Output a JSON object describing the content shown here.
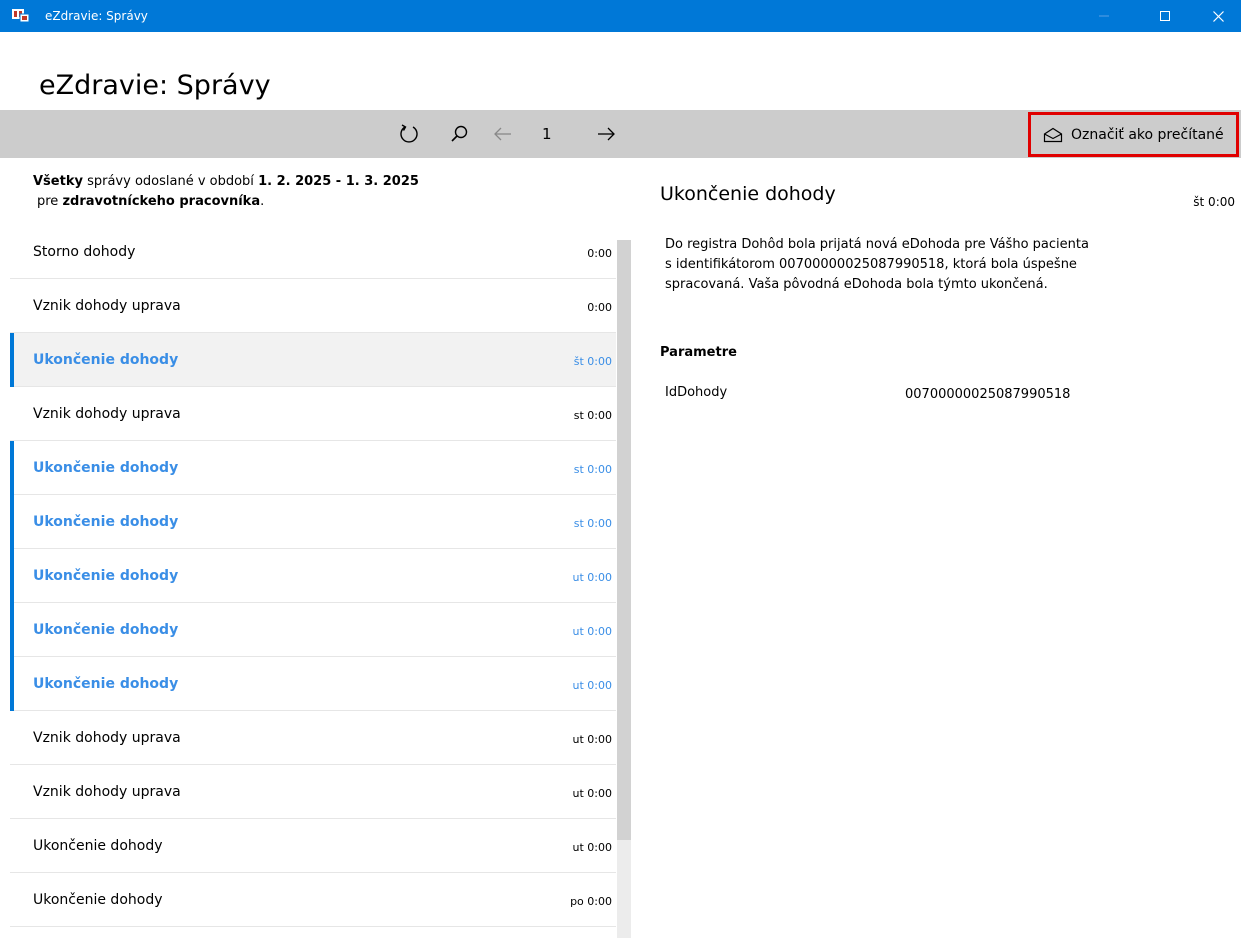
{
  "window": {
    "title": "eZdravie: Správy",
    "icon": "ezdravie-app-icon"
  },
  "page": {
    "title": "eZdravie: Správy"
  },
  "toolbar": {
    "refresh_icon": "refresh-icon",
    "search_icon": "search-icon",
    "prev_icon": "arrow-left-icon",
    "page_number": "1",
    "next_icon": "arrow-right-icon",
    "mark_read_label": "Označiť ako prečítané",
    "mark_read_icon": "open-envelope-icon",
    "highlight_color": "#e00000"
  },
  "filter": {
    "scope": "Všetky",
    "text1": " správy odoslané v období ",
    "period": "1. 2. 2025 - 1. 3. 2025",
    "text2": "pre ",
    "recipient": "zdravotníckeho pracovníka",
    "end": "."
  },
  "messages": [
    {
      "subject": "Storno dohody",
      "time": "0:00",
      "unread": false,
      "selected": false
    },
    {
      "subject": "Vznik dohody uprava",
      "time": "0:00",
      "unread": false,
      "selected": false
    },
    {
      "subject": "Ukončenie dohody",
      "time": "št 0:00",
      "unread": true,
      "selected": true
    },
    {
      "subject": "Vznik dohody uprava",
      "time": "st 0:00",
      "unread": false,
      "selected": false
    },
    {
      "subject": "Ukončenie dohody",
      "time": "st 0:00",
      "unread": true,
      "selected": false
    },
    {
      "subject": "Ukončenie dohody",
      "time": "st 0:00",
      "unread": true,
      "selected": false
    },
    {
      "subject": "Ukončenie dohody",
      "time": "ut 0:00",
      "unread": true,
      "selected": false
    },
    {
      "subject": "Ukončenie dohody",
      "time": "ut 0:00",
      "unread": true,
      "selected": false
    },
    {
      "subject": "Ukončenie dohody",
      "time": "ut 0:00",
      "unread": true,
      "selected": false
    },
    {
      "subject": "Vznik dohody uprava",
      "time": "ut 0:00",
      "unread": false,
      "selected": false
    },
    {
      "subject": "Vznik dohody uprava",
      "time": "ut 0:00",
      "unread": false,
      "selected": false
    },
    {
      "subject": "Ukončenie dohody",
      "time": "ut 0:00",
      "unread": false,
      "selected": false
    },
    {
      "subject": "Ukončenie dohody",
      "time": "po 0:00",
      "unread": false,
      "selected": false
    }
  ],
  "detail": {
    "title": "Ukončenie dohody",
    "time": "št 0:00",
    "body_line1": "Do registra Dohôd bola prijatá nová eDohoda pre Vášho pacienta",
    "body_line2": "s identifikátorom 00700000025087990518, ktorá bola úspešne",
    "body_line3": "spracovaná. Vaša pôvodná eDohoda bola týmto ukončená.",
    "params_heading": "Parametre",
    "params": [
      {
        "name": "IdDohody",
        "value": "00700000025087990518"
      }
    ]
  },
  "colors": {
    "titlebar": "#0078d7",
    "toolbar": "#cccccc",
    "unread_text": "#3a8ee6",
    "accent": "#0078d7",
    "selected_bg": "#f2f2f2"
  }
}
